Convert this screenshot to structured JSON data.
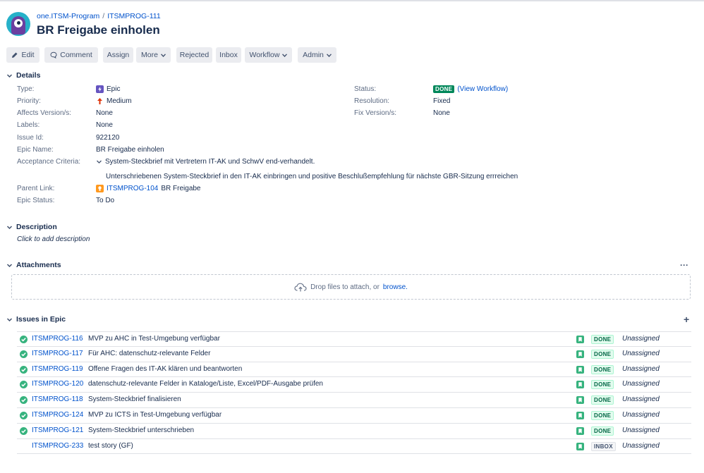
{
  "header": {
    "breadcrumb": [
      "one.ITSM-Program",
      "ITSMPROG-111"
    ],
    "breadcrumb_sep": "/",
    "title": "BR Freigabe einholen"
  },
  "toolbar": {
    "edit": "Edit",
    "comment": "Comment",
    "assign": "Assign",
    "more": "More",
    "rejected": "Rejected",
    "inbox": "Inbox",
    "workflow": "Workflow",
    "admin": "Admin"
  },
  "details": {
    "heading": "Details",
    "type_label": "Type:",
    "type_value": "Epic",
    "priority_label": "Priority:",
    "priority_value": "Medium",
    "affects_label": "Affects Version/s:",
    "affects_value": "None",
    "labels_label": "Labels:",
    "labels_value": "None",
    "issueid_label": "Issue Id:",
    "issueid_value": "922120",
    "epicname_label": "Epic Name:",
    "epicname_value": "BR Freigabe einholen",
    "acceptance_label": "Acceptance Criteria:",
    "acceptance_line1": "System-Steckbrief mit Vertretern IT-AK und SchwV end-verhandelt.",
    "acceptance_line2": "Unterschriebenen System-Steckbrief in den IT-AK einbringen und positive Beschlußempfehlung für nächste GBR-Sitzung errreichen",
    "parent_label": "Parent Link:",
    "parent_key": "ITSMPROG-104",
    "parent_title": "BR Freigabe",
    "epicstatus_label": "Epic Status:",
    "epicstatus_value": "To Do",
    "status_label": "Status:",
    "status_value": "DONE",
    "status_link": "(View Workflow)",
    "resolution_label": "Resolution:",
    "resolution_value": "Fixed",
    "fixversion_label": "Fix Version/s:",
    "fixversion_value": "None"
  },
  "description": {
    "heading": "Description",
    "placeholder": "Click to add description"
  },
  "attachments": {
    "heading": "Attachments",
    "more": "···",
    "drop_text": "Drop files to attach, or",
    "browse": "browse."
  },
  "issues_in_epic": {
    "heading": "Issues in Epic",
    "add": "+",
    "rows": [
      {
        "key": "ITSMPROG-116",
        "summary": "MVP zu AHC in Test-Umgebung verfügbar",
        "status": "DONE",
        "assignee": "Unassigned",
        "resolved": true
      },
      {
        "key": "ITSMPROG-117",
        "summary": "Für AHC: datenschutz-relevante Felder",
        "status": "DONE",
        "assignee": "Unassigned",
        "resolved": true
      },
      {
        "key": "ITSMPROG-119",
        "summary": "Offene Fragen des IT-AK klären und beantworten",
        "status": "DONE",
        "assignee": "Unassigned",
        "resolved": true
      },
      {
        "key": "ITSMPROG-120",
        "summary": "datenschutz-relevante Felder in Kataloge/Liste, Excel/PDF-Ausgabe prüfen",
        "status": "DONE",
        "assignee": "Unassigned",
        "resolved": true
      },
      {
        "key": "ITSMPROG-118",
        "summary": "System-Steckbrief finalisieren",
        "status": "DONE",
        "assignee": "Unassigned",
        "resolved": true
      },
      {
        "key": "ITSMPROG-124",
        "summary": "MVP zu ICTS in Test-Umgebung verfügbar",
        "status": "DONE",
        "assignee": "Unassigned",
        "resolved": true
      },
      {
        "key": "ITSMPROG-121",
        "summary": "System-Steckbrief unterschrieben",
        "status": "DONE",
        "assignee": "Unassigned",
        "resolved": true
      },
      {
        "key": "ITSMPROG-233",
        "summary": "test story (GF)",
        "status": "INBOX",
        "assignee": "Unassigned",
        "resolved": false
      }
    ]
  },
  "colors": {
    "link": "#0052cc",
    "done_green": "#00875a",
    "story_green": "#36b37e",
    "epic_purple": "#6554c0",
    "parent_orange": "#ff991f",
    "priority_red": "#de350b"
  },
  "icons": {
    "edit": "pencil-icon",
    "comment": "comment-bubble-icon",
    "dropdown": "chevron-down-icon",
    "section_toggle": "chevron-down-icon",
    "epic": "lightning-icon",
    "priority": "arrow-up-icon",
    "parent": "bulb-icon",
    "upload": "cloud-upload-icon",
    "row_status": "check-circle-icon",
    "story": "bookmark-icon"
  }
}
